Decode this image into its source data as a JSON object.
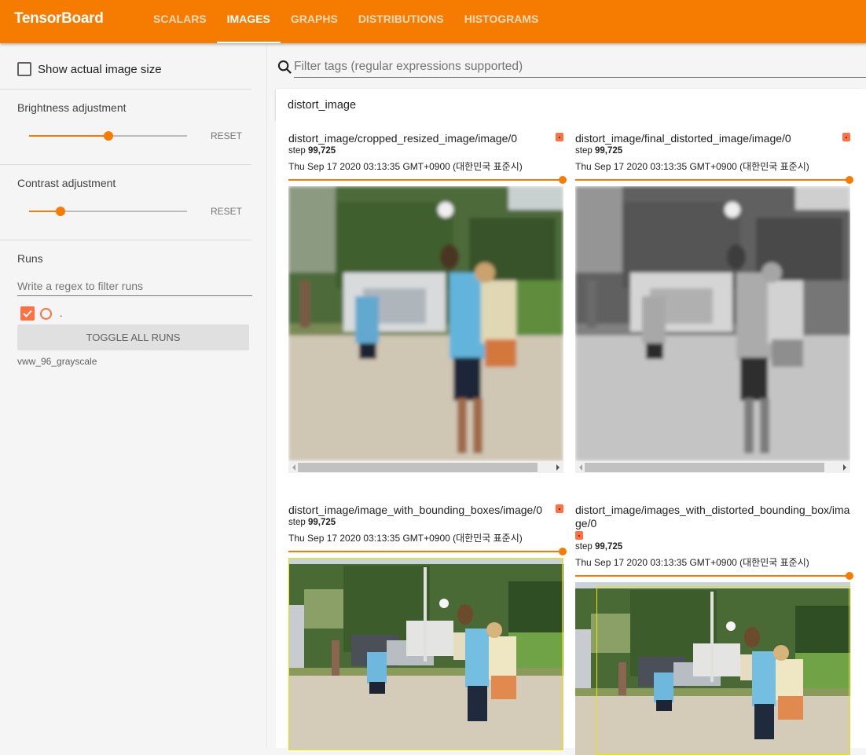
{
  "app": {
    "brand": "TensorBoard",
    "tabs": [
      {
        "label": "SCALARS",
        "active": false
      },
      {
        "label": "IMAGES",
        "active": true
      },
      {
        "label": "GRAPHS",
        "active": false
      },
      {
        "label": "DISTRIBUTIONS",
        "active": false
      },
      {
        "label": "HISTOGRAMS",
        "active": false
      }
    ],
    "accent_color": "#f57c00",
    "run_color": "#ff7043"
  },
  "sidebar": {
    "show_actual_size": {
      "label": "Show actual image size",
      "checked": false
    },
    "brightness": {
      "label": "Brightness adjustment",
      "value_fraction": 0.5,
      "reset_label": "RESET"
    },
    "contrast": {
      "label": "Contrast adjustment",
      "value_fraction": 0.2,
      "reset_label": "RESET"
    },
    "runs": {
      "title": "Runs",
      "filter_placeholder": "Write a regex to filter runs",
      "items": [
        {
          "name": ".",
          "checked": true
        }
      ],
      "toggle_all_label": "TOGGLE ALL RUNS",
      "footer_label": "vww_96_grayscale"
    }
  },
  "main": {
    "tag_filter_placeholder": "Filter tags (regular expressions supported)",
    "category": "distort_image",
    "cards": [
      {
        "title": "distort_image/cropped_resized_image/image/0",
        "step_label": "step",
        "step": "99,725",
        "wall_time": "Thu Sep 17 2020 03:13:35 GMT+0900 (대한민국 표준시)",
        "image_desc": "blurry color beach frisbee photo",
        "step_fraction": 1.0
      },
      {
        "title": "distort_image/final_distorted_image/image/0",
        "step_label": "step",
        "step": "99,725",
        "wall_time": "Thu Sep 17 2020 03:13:35 GMT+0900 (대한민국 표준시)",
        "image_desc": "blurry grayscale beach frisbee photo",
        "step_fraction": 1.0
      },
      {
        "title": "distort_image/image_with_bounding_boxes/image/0",
        "step_label": "step",
        "step": "99,725",
        "wall_time": "Thu Sep 17 2020 03:13:35 GMT+0900 (대한민국 표준시)",
        "image_desc": "beach frisbee photo with full-frame bounding box",
        "step_fraction": 1.0
      },
      {
        "title": "distort_image/images_with_distorted_bounding_box/image/0",
        "step_label": "step",
        "step": "99,725",
        "wall_time": "Thu Sep 17 2020 03:13:35 GMT+0900 (대한민국 표준시)",
        "image_desc": "beach frisbee photo with distorted bounding box",
        "step_fraction": 1.0
      }
    ]
  }
}
